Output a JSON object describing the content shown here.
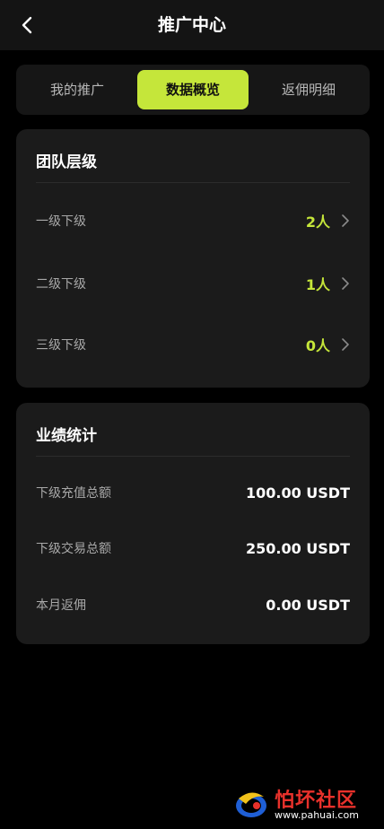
{
  "header": {
    "title": "推广中心",
    "back_icon": "chevron-left-icon"
  },
  "tabs": [
    {
      "label": "我的推广",
      "active": false
    },
    {
      "label": "数据概览",
      "active": true
    },
    {
      "label": "返佣明细",
      "active": false
    }
  ],
  "team": {
    "title": "团队层级",
    "rows": [
      {
        "label": "一级下级",
        "value": "2人"
      },
      {
        "label": "二级下级",
        "value": "1人"
      },
      {
        "label": "三级下级",
        "value": "0人"
      }
    ]
  },
  "performance": {
    "title": "业绩统计",
    "rows": [
      {
        "label": "下级充值总额",
        "value": "100.00 USDT"
      },
      {
        "label": "下级交易总额",
        "value": "250.00 USDT"
      },
      {
        "label": "本月返佣",
        "value": "0.00 USDT"
      }
    ]
  },
  "watermark": {
    "title": "怕坏社区",
    "url": "www.pahuai.com"
  },
  "colors": {
    "accent": "#c5e63a",
    "background": "#000000",
    "card": "#1b1b1b",
    "header": "#141414",
    "muted_text": "#a8a8a8",
    "watermark_red": "#e8312b"
  }
}
